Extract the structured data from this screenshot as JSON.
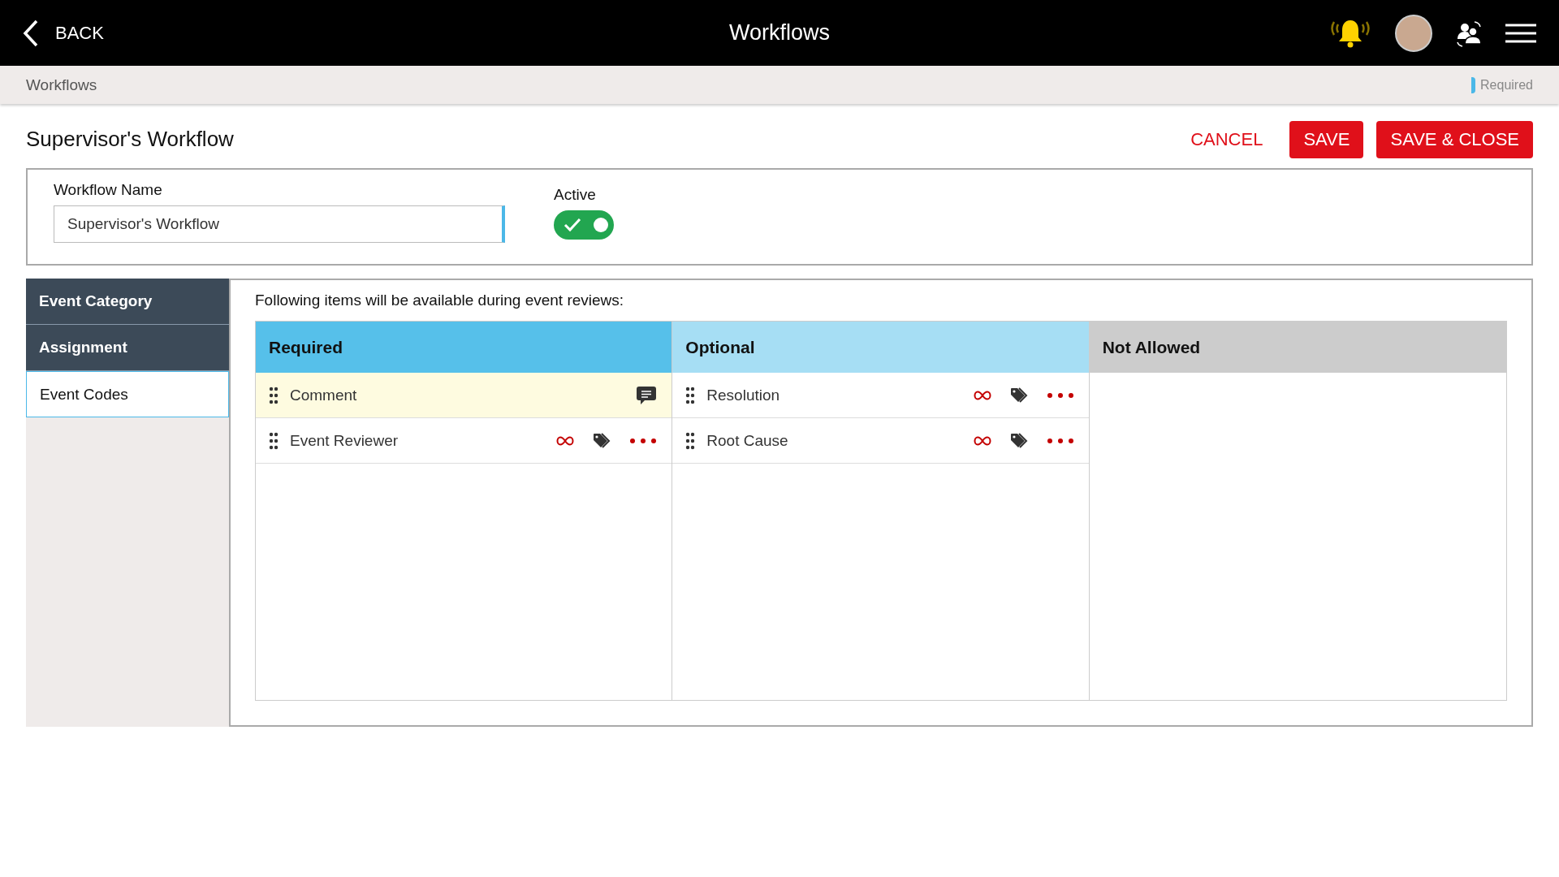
{
  "header": {
    "back_label": "BACK",
    "title": "Workflows"
  },
  "breadcrumb": {
    "label": "Workflows",
    "legend": "Required"
  },
  "page": {
    "title": "Supervisor's Workflow",
    "buttons": [
      {
        "kind": "text",
        "label": "CANCEL"
      },
      {
        "kind": "filled",
        "label": "SAVE"
      },
      {
        "kind": "filled",
        "label": "SAVE & CLOSE"
      }
    ]
  },
  "form": {
    "name_label": "Workflow Name",
    "name_value": "Supervisor's Workflow",
    "active_label": "Active",
    "active_on": true
  },
  "sidebar": {
    "items": [
      {
        "label": "Event Category",
        "selected": false
      },
      {
        "label": "Assignment",
        "selected": false
      },
      {
        "label": "Event Codes",
        "selected": true
      }
    ]
  },
  "content": {
    "intro": "Following items will be available during event reviews:",
    "columns": [
      {
        "kind": "required",
        "title": "Required",
        "items": [
          {
            "kind": "comment",
            "label": "Comment",
            "selected": true
          },
          {
            "kind": "code",
            "label": "Event Reviewer",
            "selected": false
          }
        ]
      },
      {
        "kind": "optional",
        "title": "Optional",
        "items": [
          {
            "kind": "code",
            "label": "Resolution",
            "selected": false
          },
          {
            "kind": "code",
            "label": "Root Cause",
            "selected": false
          }
        ]
      },
      {
        "kind": "none",
        "title": "Not Allowed"
      }
    ]
  }
}
